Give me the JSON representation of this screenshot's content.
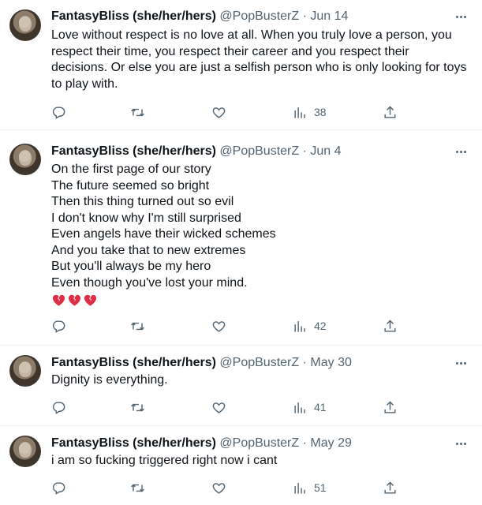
{
  "tweets": [
    {
      "name": "FantasyBliss (she/her/hers)",
      "handle": "@PopBusterZ",
      "separator": "·",
      "date": "Jun 14",
      "lines": [
        "Love without respect is no love at all. When you truly love a person, you",
        "respect their time, you respect their career and you respect their",
        "decisions. Or else you are just a selfish person who is only looking for toys",
        "to play with."
      ],
      "views": "38"
    },
    {
      "name": "FantasyBliss (she/her/hers)",
      "handle": "@PopBusterZ",
      "separator": "·",
      "date": "Jun 4",
      "lines": [
        "On the first page of our story",
        "The future seemed so bright",
        "Then this thing turned out so evil",
        "I don't know why I'm still surprised",
        "Even angels have their wicked schemes",
        "And you take that to new extremes",
        "But you'll always be my hero",
        "Even though you've lost your mind."
      ],
      "emoji": "broken-heart-icon x3",
      "views": "42"
    },
    {
      "name": "FantasyBliss (she/her/hers)",
      "handle": "@PopBusterZ",
      "separator": "·",
      "date": "May 30",
      "lines": [
        "Dignity is everything."
      ],
      "views": "41"
    },
    {
      "name": "FantasyBliss (she/her/hers)",
      "handle": "@PopBusterZ",
      "separator": "·",
      "date": "May 29",
      "lines": [
        "i am so fucking triggered right now i cant"
      ],
      "views": "51"
    }
  ],
  "icons": {
    "reply": "reply-icon",
    "retweet": "retweet-icon",
    "like": "like-icon",
    "views": "views-icon",
    "share": "share-icon",
    "more": "more-icon"
  },
  "colors": {
    "text": "#0f1419",
    "secondary": "#536471",
    "divider": "#eff3f4",
    "heart_red": "#dd2e44"
  }
}
